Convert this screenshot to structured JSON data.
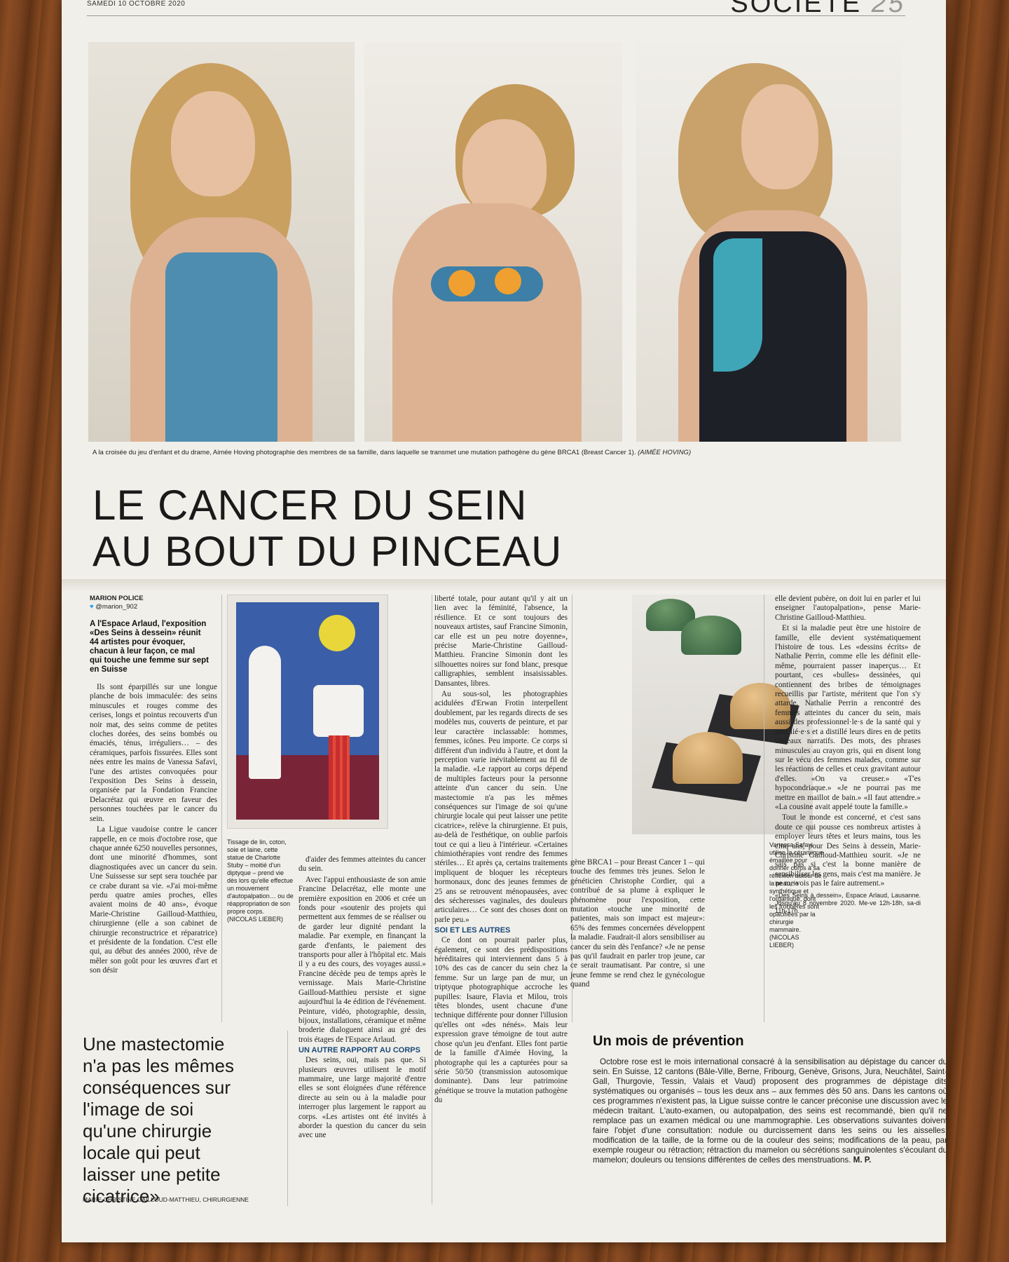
{
  "header": {
    "date": "SAMEDI 10 OCTOBRE 2020",
    "section": "SOCIÉTÉ",
    "page_number": "25"
  },
  "photos": {
    "caption": "A la croisée du jeu d'enfant et du drame, Aimée Hoving photographie des membres de sa famille, dans laquelle se transmet une mutation pathogène du gène BRCA1 (Breast Cancer 1).",
    "credit": "(AIMÉE HOVING)"
  },
  "headline": {
    "line1": "LE CANCER DU SEIN",
    "line2": "AU BOUT DU PINCEAU"
  },
  "byline": {
    "author": "MARION POLICE",
    "handle": "@marion_902"
  },
  "lede": "A l'Espace Arlaud, l'exposition «Des Seins à dessein» réunit 44 artistes pour évoquer, chacun à leur façon, ce mal qui touche une femme sur sept en Suisse",
  "col1": {
    "p1": "Ils sont éparpillés sur une longue planche de bois immaculée: des seins minuscules et rouges comme des cerises, longs et pointus recouverts d'un noir mat, des seins comme de petites cloches dorées, des seins bombés ou émaciés, ténus, irréguliers… – des céramiques, parfois fissurées. Elles sont nées entre les mains de Vanessa Safavi, l'une des artistes convoquées pour l'exposition Des Seins à dessein, organisée par la Fondation Francine Delacrétaz qui œuvre en faveur des personnes touchées par le cancer du sein.",
    "p2": "La Ligue vaudoise contre le cancer rappelle, en ce mois d'octobre rose, que chaque année 6250 nouvelles personnes, dont une minorité d'hommes, sont diagnostiquées avec un cancer du sein. Une Suissesse sur sept sera touchée par ce crabe durant sa vie. «J'ai moi-même perdu quatre amies proches, elles avaient moins de 40 ans», évoque Marie-Christine Gailloud-Matthieu, chirurgienne (elle a son cabinet de chirurgie reconstructrice et réparatrice) et présidente de la fondation. C'est elle qui, au début des années 2000, rêve de mêler son goût pour les œuvres d'art et son désir"
  },
  "tapestry_caption": "Tissage de lin, coton, soie et laine, cette statue de Charlotte Stuby – moitié d'un diptyque – prend vie dès lors qu'elle effectue un mouvement d'autopalpation… ou de réappropriation de son propre corps. (NICOLAS LIEBER)",
  "col2": {
    "p1": "d'aider des femmes atteintes du cancer du sein.",
    "p2": "Avec l'appui enthousiaste de son amie Francine Delacrétaz, elle monte une première exposition en 2006 et crée un fonds pour «soutenir des projets qui permettent aux femmes de se réaliser ou de garder leur dignité pendant la maladie. Par exemple, en finançant la garde d'enfants, le paiement des transports pour aller à l'hôpital etc. Mais il y a eu des cours, des voyages aussi.» Francine décède peu de temps après le vernissage. Mais Marie-Christine Gailloud-Matthieu persiste et signe aujourd'hui la 4e édition de l'événement. Peinture, vidéo, photographie, dessin, bijoux, installations, céramique et même broderie dialoguent ainsi au gré des trois étages de l'Espace Arlaud.",
    "subhead": "UN AUTRE RAPPORT AU CORPS",
    "p3": "Des seins, oui, mais pas que. Si plusieurs œuvres utilisent le motif mammaire, une large majorité d'entre elles se sont éloignées d'une référence directe au sein ou à la maladie pour interroger plus largement le rapport au corps. «Les artistes ont été invités à aborder la question du cancer du sein avec une"
  },
  "col3": {
    "p1": "liberté totale, pour autant qu'il y ait un lien avec la féminité, l'absence, la résilience. Et ce sont toujours des nouveaux artistes, sauf Francine Simonin, car elle est un peu notre doyenne», précise Marie-Christine Gailloud-Matthieu. Francine Simonin dont les silhouettes noires sur fond blanc, presque calligraphies, semblent insaisissables. Dansantes, libres.",
    "p2": "Au sous-sol, les photographies acidulées d'Erwan Frotin interpellent doublement, par les regards directs de ses modèles nus, couverts de peinture, et par leur caractère inclassable: hommes, femmes, icônes. Peu importe. Ce corps si différent d'un individu à l'autre, et dont la perception varie inévitablement au fil de la maladie. «Le rapport au corps dépend de multiples facteurs pour la personne atteinte d'un cancer du sein. Une mastectomie n'a pas les mêmes conséquences sur l'image de soi qu'une chirurgie locale qui peut laisser une petite cicatrice», relève la chirurgienne. Et puis, au-delà de l'esthétique, on oublie parfois tout ce qui a lieu à l'intérieur. «Certaines chimiothérapies vont rendre des femmes stériles… Et après ça, certains traitements impliquent de bloquer les récepteurs hormonaux, donc des jeunes femmes de 25 ans se retrouvent ménopausées, avec des sécheresses vaginales, des douleurs articulaires… Ce sont des choses dont on parle peu.»",
    "subhead": "SOI ET LES AUTRES",
    "p3": "Ce dont on pourrait parler plus, également, ce sont des prédispositions héréditaires qui interviennent dans 5 à 10% des cas de cancer du sein chez la femme. Sur un large pan de mur, un triptyque photographique accroche les pupilles: Isaure, Flavia et Milou, trois têtes blondes, usent chacune d'une technique différente pour donner l'illusion qu'elles ont «des nénés». Mais leur expression grave témoigne de tout autre chose qu'un jeu d'enfant. Elles font partie de la famille d'Aimée Hoving, la photographe qui les a capturées pour sa série 50/50 (transmission autosomique dominante). Dans leur patrimoine génétique se trouve la mutation pathogène du"
  },
  "ceramic_caption": "Vanessa Safavi utilise la céramique émaillée pour donner corps à sa réflexion autour de la peau, le synthétique et l'organique, dont les frontières sont opacifiées par la chirurgie mammaire. (NICOLAS LIEBER)",
  "col4": {
    "p1": "gène BRCA1 – pour Breast Cancer 1 – qui touche des femmes très jeunes. Selon le généticien Christophe Cordier, qui a contribué de sa plume à expliquer le phénomène pour l'exposition, cette mutation «touche une minorité de patientes, mais son impact est majeur»: 65% des femmes concernées développent la maladie. Faudrait-il alors sensibiliser au cancer du sein dès l'enfance? «Je ne pense pas qu'il faudrait en parler trop jeune, car ce serait traumatisant. Par contre, si une jeune femme se rend chez le gynécologue quand"
  },
  "col5": {
    "p1": "elle devient pubère, on doit lui en parler et lui enseigner l'autopalpation», pense Marie-Christine Gailloud-Matthieu.",
    "p2": "Et si la maladie peut être une histoire de famille, elle devient systématiquement l'histoire de tous. Les «dessins écrits» de Nathalie Perrin, comme elle les définit elle-même, pourraient passer inaperçus… Et pourtant, ces «bulles» dessinées, qui contiennent des bribes de témoignages recueillis par l'artiste, méritent que l'on s'y attarde. Nathalie Perrin a rencontré des femmes atteintes du cancer du sein, mais aussi des professionnel·le·s de la santé qui y sont lié·e·s et a distillé leurs dires en de petits tableaux narratifs. Des mots, des phrases minuscules au crayon gris, qui en disent long sur le vécu des femmes malades, comme sur les réactions de celles et ceux gravitant autour d'elles. «On va creuser.» «T'es hypocondriaque.» «Je ne pourrai pas me mettre en maillot de bain.» «Il faut attendre.» «La cousine avait appelé toute la famille.»",
    "p3": "Tout le monde est concerné, et c'est sans doute ce qui pousse ces nombreux artistes à employer leurs têtes et leurs mains, tous les cinq ans, pour Des Seins à dessein, Marie-Christine Gailloud-Matthieu sourit. «Je ne sais pas si c'est la bonne manière de sensibiliser les gens, mais c'est ma manière. Je ne me vois pas le faire autrement.»",
    "info": "«Des Seins à dessein», Espace Arlaud, Lausanne. Jusqu'au 8 novembre 2020. Me-ve 12h-18h, sa-di 11h-17h."
  },
  "pull_quote": {
    "text": "Une mastectomie n'a pas les mêmes conséquences sur l'image de soi qu'une chirurgie locale qui peut laisser une petite cicatrice»",
    "attribution": "MARIE-CHRISTINE GAILLOUD-MATTHIEU, CHIRURGIENNE"
  },
  "box": {
    "title": "Un mois de prévention",
    "text": "Octobre rose est le mois international consacré à la sensibilisation au dépistage du cancer du sein. En Suisse, 12 cantons (Bâle-Ville, Berne, Fribourg, Genève, Grisons, Jura, Neuchâtel, Saint-Gall, Thurgovie, Tessin, Valais et Vaud) proposent des programmes de dépistage dits systématiques ou organisés – tous les deux ans – aux femmes dès 50 ans. Dans les cantons où ces programmes n'existent pas, la Ligue suisse contre le cancer préconise une discussion avec le médecin traitant. L'auto-examen, ou autopalpation, des seins est recommandé, bien qu'il ne remplace pas un examen médical ou une mammographie. Les observations suivantes doivent faire l'objet d'une consultation: nodule ou durcissement dans les seins ou les aisselles; modification de la taille, de la forme ou de la couleur des seins; modifications de la peau, par exemple rougeur ou rétraction; rétraction du mamelon ou sécrétions sanguinolentes s'écoulant du mamelon; douleurs ou tensions différentes de celles des menstruations.",
    "signature": "M. P."
  }
}
